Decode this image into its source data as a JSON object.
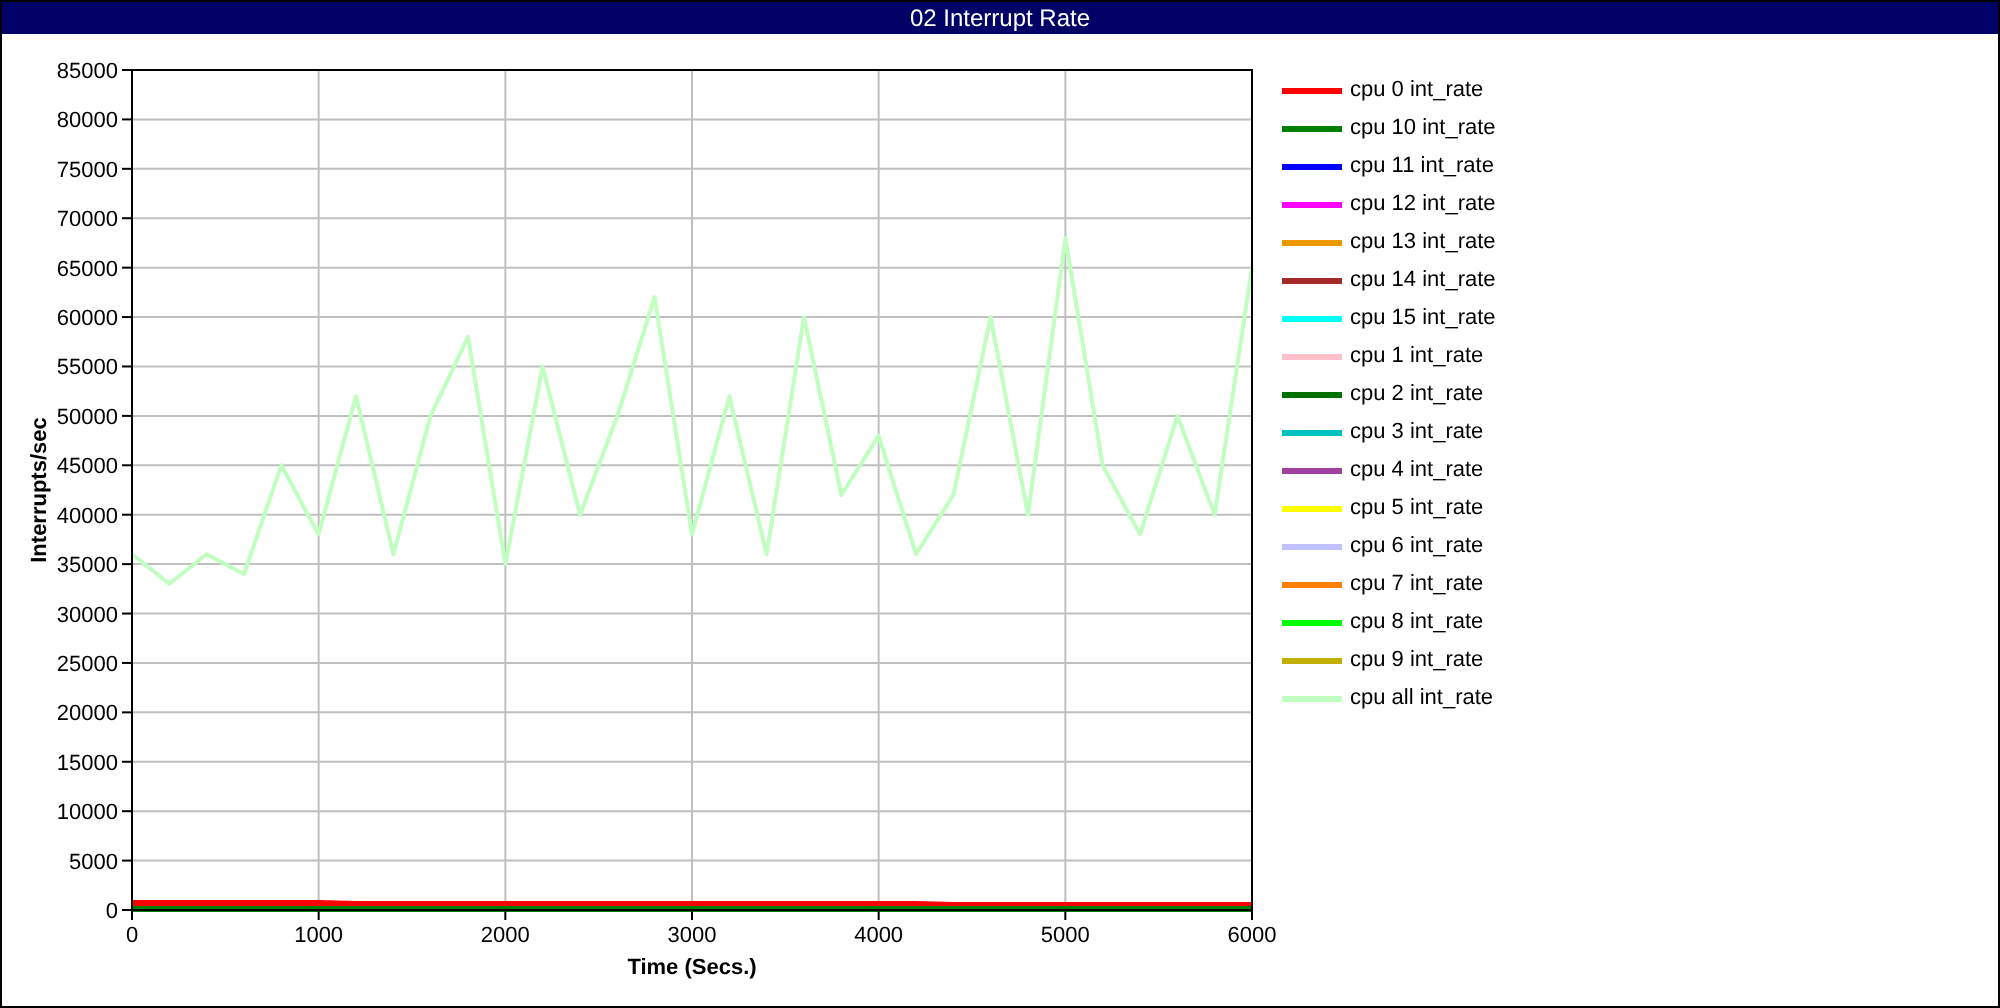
{
  "window": {
    "title": "02 Interrupt Rate"
  },
  "chart_data": {
    "type": "line",
    "grid": true,
    "xlabel": "Time (Secs.)",
    "ylabel": "Interrupts/sec",
    "x": [
      0,
      200,
      400,
      600,
      800,
      1000,
      1200,
      1400,
      1600,
      1800,
      2000,
      2200,
      2400,
      2600,
      2800,
      3000,
      3200,
      3400,
      3600,
      3800,
      4000,
      4200,
      4400,
      4600,
      4800,
      5000,
      5200,
      5400,
      5600,
      5800,
      6000
    ],
    "xlim": [
      0,
      6000
    ],
    "ylim": [
      0,
      85000
    ],
    "xticks": [
      0,
      1000,
      2000,
      3000,
      4000,
      5000,
      6000
    ],
    "yticks": [
      0,
      5000,
      10000,
      15000,
      20000,
      25000,
      30000,
      35000,
      40000,
      45000,
      50000,
      55000,
      60000,
      65000,
      70000,
      75000,
      80000,
      85000
    ],
    "series": [
      {
        "name": "cpu 0 int_rate",
        "color": "#ff0000",
        "values": [
          700,
          700,
          700,
          700,
          700,
          700,
          600,
          600,
          600,
          600,
          600,
          600,
          600,
          600,
          600,
          600,
          600,
          600,
          600,
          600,
          600,
          600,
          500,
          500,
          500,
          500,
          500,
          500,
          500,
          500,
          500
        ]
      },
      {
        "name": "cpu 10 int_rate",
        "color": "#008000",
        "values": [
          100,
          100,
          100,
          100,
          100,
          100,
          100,
          100,
          100,
          100,
          100,
          100,
          100,
          100,
          100,
          100,
          100,
          100,
          100,
          100,
          100,
          100,
          100,
          100,
          100,
          100,
          100,
          100,
          100,
          100,
          100
        ]
      },
      {
        "name": "cpu 11 int_rate",
        "color": "#0000ff",
        "values": [
          null,
          null,
          null,
          null,
          null,
          null,
          null,
          null,
          null,
          null,
          null,
          null,
          null,
          null,
          null,
          null,
          null,
          null,
          null,
          null,
          null,
          null,
          null,
          null,
          null,
          null,
          null,
          null,
          null,
          null,
          null
        ]
      },
      {
        "name": "cpu 12 int_rate",
        "color": "#ff00ff",
        "values": [
          null,
          null,
          null,
          null,
          null,
          null,
          null,
          null,
          null,
          null,
          null,
          null,
          null,
          null,
          null,
          null,
          null,
          null,
          null,
          null,
          null,
          null,
          null,
          null,
          null,
          null,
          null,
          null,
          null,
          null,
          null
        ]
      },
      {
        "name": "cpu 13 int_rate",
        "color": "#ee9900",
        "values": [
          null,
          null,
          null,
          null,
          null,
          null,
          null,
          null,
          null,
          null,
          null,
          null,
          null,
          null,
          null,
          null,
          null,
          null,
          null,
          null,
          null,
          null,
          null,
          null,
          null,
          null,
          null,
          null,
          null,
          null,
          null
        ]
      },
      {
        "name": "cpu 14 int_rate",
        "color": "#a52a2a",
        "values": [
          null,
          null,
          null,
          null,
          null,
          null,
          null,
          null,
          null,
          null,
          null,
          null,
          null,
          null,
          null,
          null,
          null,
          null,
          null,
          null,
          null,
          null,
          null,
          null,
          null,
          null,
          null,
          null,
          null,
          null,
          null
        ]
      },
      {
        "name": "cpu 15 int_rate",
        "color": "#00ffff",
        "values": [
          null,
          null,
          null,
          null,
          null,
          null,
          null,
          null,
          null,
          null,
          null,
          null,
          null,
          null,
          null,
          null,
          null,
          null,
          null,
          null,
          null,
          null,
          null,
          null,
          null,
          null,
          null,
          null,
          null,
          null,
          null
        ]
      },
      {
        "name": "cpu 1 int_rate",
        "color": "#ffc0cb",
        "values": [
          null,
          null,
          null,
          null,
          null,
          null,
          null,
          null,
          null,
          null,
          null,
          null,
          null,
          null,
          null,
          null,
          null,
          null,
          null,
          null,
          null,
          null,
          null,
          null,
          null,
          null,
          null,
          null,
          null,
          null,
          null
        ]
      },
      {
        "name": "cpu 2 int_rate",
        "color": "#007000",
        "values": [
          null,
          null,
          null,
          null,
          null,
          null,
          null,
          null,
          null,
          null,
          null,
          null,
          null,
          null,
          null,
          null,
          null,
          null,
          null,
          null,
          null,
          null,
          null,
          null,
          null,
          null,
          null,
          null,
          null,
          null,
          null
        ]
      },
      {
        "name": "cpu 3 int_rate",
        "color": "#00c0c0",
        "values": [
          null,
          null,
          null,
          null,
          null,
          null,
          null,
          null,
          null,
          null,
          null,
          null,
          null,
          null,
          null,
          null,
          null,
          null,
          null,
          null,
          null,
          null,
          null,
          null,
          null,
          null,
          null,
          null,
          null,
          null,
          null
        ]
      },
      {
        "name": "cpu 4 int_rate",
        "color": "#a040a0",
        "values": [
          null,
          null,
          null,
          null,
          null,
          null,
          null,
          null,
          null,
          null,
          null,
          null,
          null,
          null,
          null,
          null,
          null,
          null,
          null,
          null,
          null,
          null,
          null,
          null,
          null,
          null,
          null,
          null,
          null,
          null,
          null
        ]
      },
      {
        "name": "cpu 5 int_rate",
        "color": "#ffff00",
        "values": [
          null,
          null,
          null,
          null,
          null,
          null,
          null,
          null,
          null,
          null,
          null,
          null,
          null,
          null,
          null,
          null,
          null,
          null,
          null,
          null,
          null,
          null,
          null,
          null,
          null,
          null,
          null,
          null,
          null,
          null,
          null
        ]
      },
      {
        "name": "cpu 6 int_rate",
        "color": "#c0c0ff",
        "values": [
          null,
          null,
          null,
          null,
          null,
          null,
          null,
          null,
          null,
          null,
          null,
          null,
          null,
          null,
          null,
          null,
          null,
          null,
          null,
          null,
          null,
          null,
          null,
          null,
          null,
          null,
          null,
          null,
          null,
          null,
          null
        ]
      },
      {
        "name": "cpu 7 int_rate",
        "color": "#ff8000",
        "values": [
          null,
          null,
          null,
          null,
          null,
          null,
          null,
          null,
          null,
          null,
          null,
          null,
          null,
          null,
          null,
          null,
          null,
          null,
          null,
          null,
          null,
          null,
          null,
          null,
          null,
          null,
          null,
          null,
          null,
          null,
          null
        ]
      },
      {
        "name": "cpu 8 int_rate",
        "color": "#00ff00",
        "values": [
          null,
          null,
          null,
          null,
          null,
          null,
          null,
          null,
          null,
          null,
          null,
          null,
          null,
          null,
          null,
          null,
          null,
          null,
          null,
          null,
          null,
          null,
          null,
          null,
          null,
          null,
          null,
          null,
          null,
          null,
          null
        ]
      },
      {
        "name": "cpu 9 int_rate",
        "color": "#c0b000",
        "values": [
          null,
          null,
          null,
          null,
          null,
          null,
          null,
          null,
          null,
          null,
          null,
          null,
          null,
          null,
          null,
          null,
          null,
          null,
          null,
          null,
          null,
          null,
          null,
          null,
          null,
          null,
          null,
          null,
          null,
          null,
          null
        ]
      },
      {
        "name": "cpu all int_rate",
        "color": "#c0ffc0",
        "values": [
          36000,
          33000,
          36000,
          34000,
          45000,
          38000,
          52000,
          36000,
          50000,
          58000,
          35000,
          55000,
          40000,
          50000,
          62000,
          38000,
          52000,
          36000,
          60000,
          42000,
          48000,
          36000,
          42000,
          60000,
          40000,
          68000,
          45000,
          38000,
          50000,
          40000,
          65000
        ]
      }
    ]
  }
}
